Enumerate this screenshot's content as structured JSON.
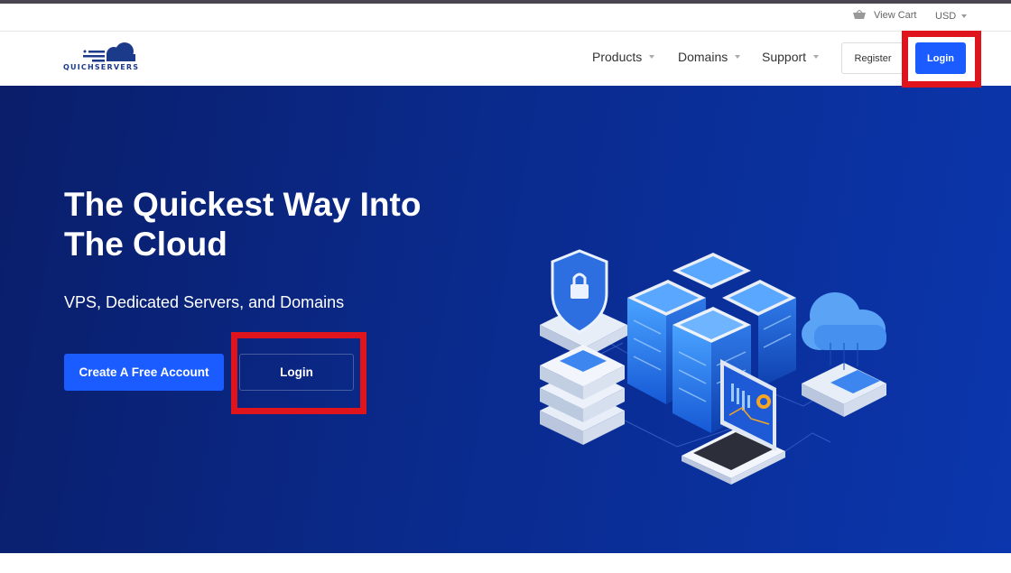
{
  "utility": {
    "cart_label": "View Cart",
    "currency": "USD"
  },
  "header": {
    "logo_text": "QUICHSERVERS",
    "nav": [
      {
        "label": "Products"
      },
      {
        "label": "Domains"
      },
      {
        "label": "Support"
      }
    ],
    "register_label": "Register",
    "login_label": "Login"
  },
  "hero": {
    "title_line1": "The Quickest Way Into",
    "title_line2": "The Cloud",
    "subtitle": "VPS, Dedicated Servers, and Domains",
    "create_account_label": "Create A Free Account",
    "login_label": "Login"
  },
  "icons": {
    "cart": "basket-icon",
    "logo": "cloud-logo-icon"
  },
  "colors": {
    "accent": "#1a5cff",
    "hero_dark": "#0a1e6a",
    "hero_light": "#0b36ad",
    "highlight": "#e0141c"
  }
}
